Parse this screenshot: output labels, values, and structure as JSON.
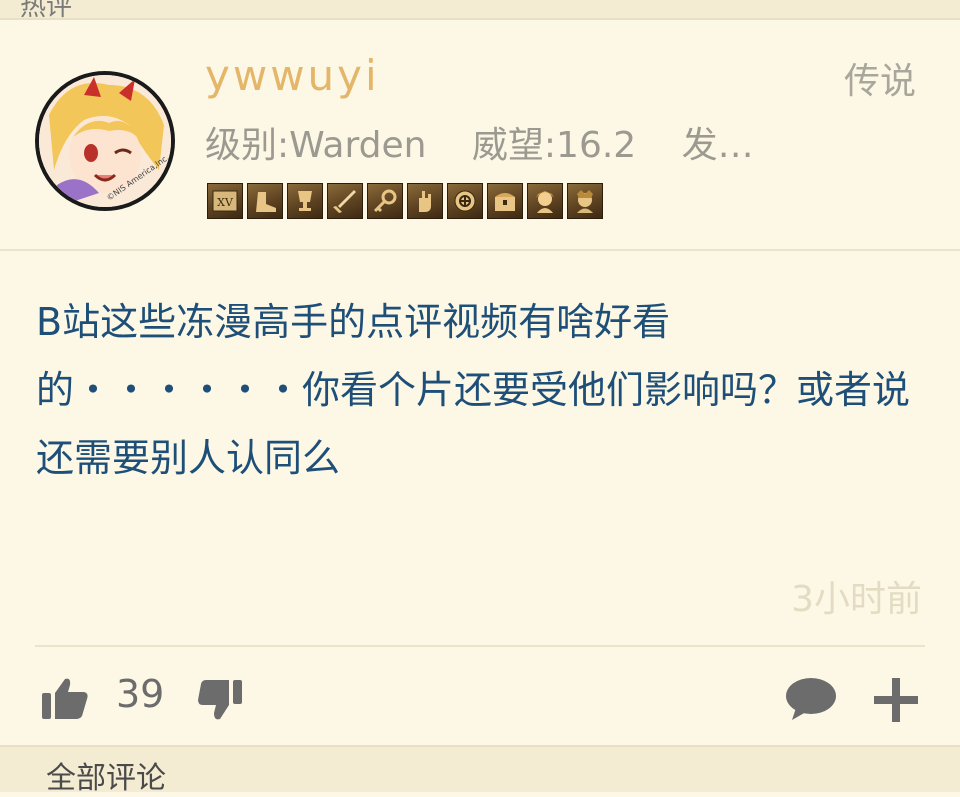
{
  "top_section": {
    "label": "热评"
  },
  "post": {
    "username": "ywwuyi",
    "rank_title": "传说",
    "meta": {
      "level": "级别:Warden",
      "prestige": "威望:16.2",
      "posts": "发…"
    },
    "badges": [
      "roman-xv-icon",
      "boot-icon",
      "trophy-icon",
      "sword-icon",
      "key-icon",
      "hand-icon",
      "coin-icon",
      "chest-icon",
      "character-icon",
      "character-2-icon"
    ],
    "content": "B站这些冻漫高手的点评视频有啥好看的・・・・・・你看个片还要受他们影响吗？或者说还需要别人认同么",
    "timestamp": "3小时前",
    "like_count": "39"
  },
  "bottom_section": {
    "label": "全部评论"
  },
  "colors": {
    "background": "#fdf8e6",
    "username": "#e3b669",
    "content": "#1e4f78",
    "muted": "#9c9a90",
    "icon": "#6c6c6c"
  }
}
